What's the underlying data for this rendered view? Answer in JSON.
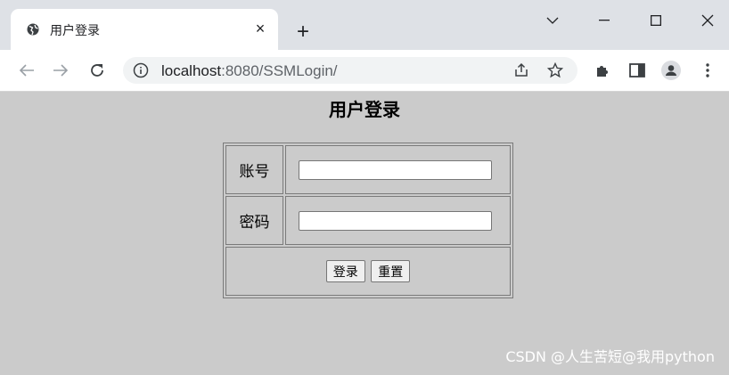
{
  "browser": {
    "tab_title": "用户登录",
    "url_host": "localhost",
    "url_rest": ":8080/SSMLogin/",
    "tab_close": "×",
    "new_tab": "+"
  },
  "page": {
    "heading": "用户登录",
    "account_label": "账号",
    "password_label": "密码",
    "account_value": "",
    "password_value": "",
    "login_button": "登录",
    "reset_button": "重置"
  },
  "watermark": "CSDN @人生苦短@我用python",
  "colors": {
    "page_background": "#cbcbcb",
    "tabbar_background": "#dee1e6"
  }
}
